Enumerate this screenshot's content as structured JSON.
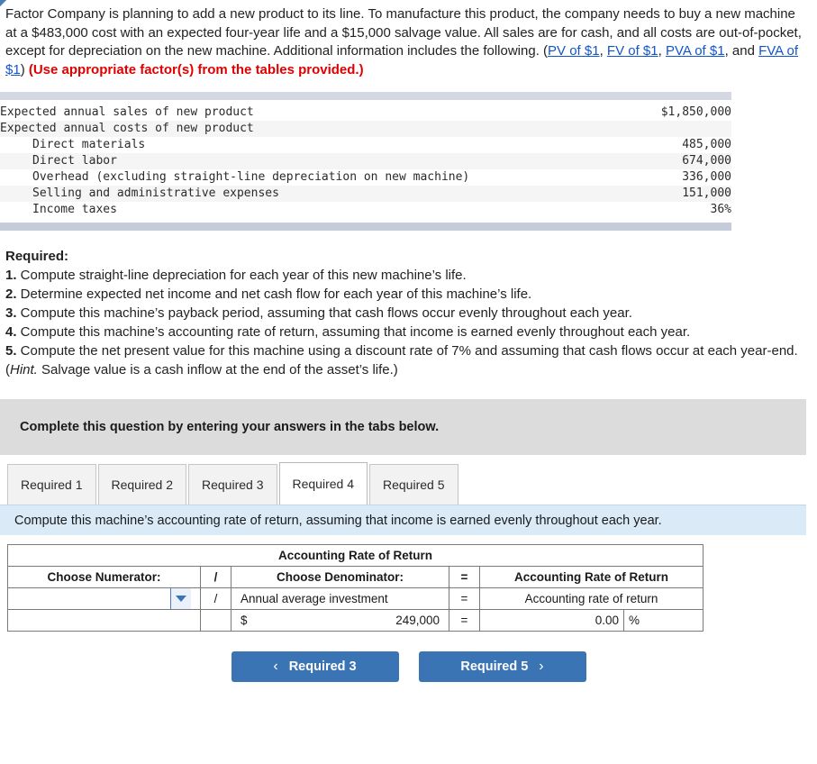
{
  "intro": {
    "part1": "Factor Company is planning to add a new product to its line. To manufacture this product, the company needs to buy a new machine at a $483,000 cost with an expected four-year life and a $15,000 salvage value. All sales are for cash, and all costs are out-of-pocket, except for depreciation on the new machine. Additional information includes the following. (",
    "link1": "PV of $1",
    "sep1": ", ",
    "link2": "FV of $1",
    "sep2": ", ",
    "link3": "PVA of $1",
    "sep3": ", and ",
    "link4": "FVA of $1",
    "part2": ") ",
    "emphasis": "(Use appropriate factor(s) from the tables provided.)"
  },
  "data_table": {
    "rows": [
      {
        "label": "Expected annual sales of new product",
        "value": "$1,850,000",
        "indent": false,
        "shade": false
      },
      {
        "label": "Expected annual costs of new product",
        "value": "",
        "indent": false,
        "shade": true
      },
      {
        "label": "Direct materials",
        "value": "485,000",
        "indent": true,
        "shade": false
      },
      {
        "label": "Direct labor",
        "value": "674,000",
        "indent": true,
        "shade": true
      },
      {
        "label": "Overhead (excluding straight-line depreciation on new machine)",
        "value": "336,000",
        "indent": true,
        "shade": false
      },
      {
        "label": "Selling and administrative expenses",
        "value": "151,000",
        "indent": true,
        "shade": true
      },
      {
        "label": "Income taxes",
        "value": "36%",
        "indent": true,
        "shade": false
      }
    ]
  },
  "required": {
    "heading": "Required:",
    "items": [
      {
        "num": "1.",
        "text": " Compute straight-line depreciation for each year of this new machine’s life."
      },
      {
        "num": "2.",
        "text": " Determine expected net income and net cash flow for each year of this machine’s life."
      },
      {
        "num": "3.",
        "text": " Compute this machine’s payback period, assuming that cash flows occur evenly throughout each year."
      },
      {
        "num": "4.",
        "text": " Compute this machine’s accounting rate of return, assuming that income is earned evenly throughout each year."
      }
    ],
    "item5": {
      "num": "5.",
      "text_a": " Compute the net present value for this machine using a discount rate of 7% and assuming that cash flows occur at each year-end. (",
      "hint": "Hint.",
      "text_b": " Salvage value is a cash inflow at the end of the asset’s life.)"
    }
  },
  "banner": {
    "text": "Complete this question by entering your answers in the tabs below."
  },
  "tabs": {
    "items": [
      {
        "label": "Required 1",
        "active": false
      },
      {
        "label": "Required 2",
        "active": false
      },
      {
        "label": "Required 3",
        "active": false
      },
      {
        "label": "Required 4",
        "active": true
      },
      {
        "label": "Required 5",
        "active": false
      }
    ]
  },
  "instruction": {
    "text": "Compute this machine’s accounting rate of return, assuming that income is earned evenly throughout each year."
  },
  "arr": {
    "title": "Accounting Rate of Return",
    "header": {
      "numerator": "Choose Numerator:",
      "divide": "/",
      "denominator": "Choose Denominator:",
      "equals": "=",
      "result": "Accounting Rate of Return"
    },
    "row1": {
      "numerator_value": "",
      "numerator_placeholder": "",
      "divide": "/",
      "denominator_value": "Annual average investment",
      "equals": "=",
      "result": "Accounting rate of return"
    },
    "row2": {
      "numerator_value": "",
      "divide": "",
      "denominator_currency": "$",
      "denominator_value": "249,000",
      "equals": "=",
      "result_value": "0.00",
      "result_unit": "%"
    }
  },
  "nav": {
    "prev_chevron": "‹",
    "prev_label": "Required 3",
    "next_label": "Required 5",
    "next_chevron": "›"
  },
  "colors": {
    "header_blue": "#7cb0e8",
    "band_blue": "#daeaf7",
    "banner_grey": "#dcdcdc",
    "button_blue": "#3a74b5",
    "answer_yellow": "#fdf5b8",
    "link_blue": "#1155cc",
    "emphasis_red": "#e00000"
  }
}
